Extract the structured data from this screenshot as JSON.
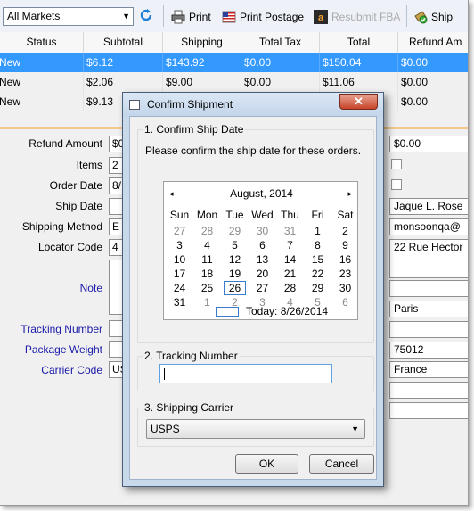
{
  "toolbar": {
    "market_select": "All Markets",
    "print_label": "Print",
    "print_postage_label": "Print Postage",
    "resubmit_fba_label": "Resubmit FBA",
    "ship_label": "Ship",
    "icons": [
      "refresh-icon",
      "printer-icon",
      "postage-flag-icon",
      "amazon-icon",
      "ship-icon"
    ]
  },
  "grid": {
    "columns": [
      "Status",
      "Subtotal",
      "Shipping",
      "Total Tax",
      "Total",
      "Refund Am"
    ],
    "rows": [
      {
        "status": "New",
        "subtotal": "$6.12",
        "shipping": "$143.92",
        "tax": "$0.00",
        "total": "$150.04",
        "refund": "$0.00",
        "selected": true
      },
      {
        "status": "New",
        "subtotal": "$2.06",
        "shipping": "$9.00",
        "tax": "$0.00",
        "total": "$11.06",
        "refund": "$0.00",
        "selected": false
      },
      {
        "status": "New",
        "subtotal": "$9.13",
        "shipping": "",
        "tax": "",
        "total": "",
        "refund": "$0.00",
        "selected": false
      }
    ]
  },
  "form": {
    "labels": {
      "refund_amount": "Refund Amount",
      "items": "Items",
      "order_date": "Order Date",
      "ship_date": "Ship Date",
      "shipping_method": "Shipping Method",
      "locator_code": "Locator Code",
      "note": "Note",
      "tracking_number": "Tracking Number",
      "package_weight": "Package Weight",
      "carrier_code": "Carrier Code"
    },
    "values": {
      "refund_amount": "$0",
      "items": "2",
      "order_date": "8/",
      "shipping_method": "E",
      "locator_code": "4",
      "carrier_code": "US"
    },
    "right": {
      "refund": "$0.00",
      "name": "Jaque L. Rose",
      "email": "monsoonqa@",
      "address": "22 Rue Hector",
      "city": "Paris",
      "zip": "75012",
      "country": "France"
    }
  },
  "dialog": {
    "title": "Confirm Shipment",
    "close_glyph": "✕",
    "section1_title": "1. Confirm Ship Date",
    "instruction": "Please confirm the ship date for these orders.",
    "calendar": {
      "month": "August, 2014",
      "prev": "◂",
      "next": "▸",
      "dow": [
        "Sun",
        "Mon",
        "Tue",
        "Wed",
        "Thu",
        "Fri",
        "Sat"
      ],
      "weeks": [
        [
          "27",
          "28",
          "29",
          "30",
          "31",
          "1",
          "2"
        ],
        [
          "3",
          "4",
          "5",
          "6",
          "7",
          "8",
          "9"
        ],
        [
          "10",
          "11",
          "12",
          "13",
          "14",
          "15",
          "16"
        ],
        [
          "17",
          "18",
          "19",
          "20",
          "21",
          "22",
          "23"
        ],
        [
          "24",
          "25",
          "26",
          "27",
          "28",
          "29",
          "30"
        ],
        [
          "31",
          "1",
          "2",
          "3",
          "4",
          "5",
          "6"
        ]
      ],
      "selected_day": "26",
      "today_label": "Today: 8/26/2014"
    },
    "section2_title": "2. Tracking Number",
    "tracking_value": "",
    "section3_title": "3. Shipping Carrier",
    "carrier_value": "USPS",
    "ok_label": "OK",
    "cancel_label": "Cancel"
  }
}
